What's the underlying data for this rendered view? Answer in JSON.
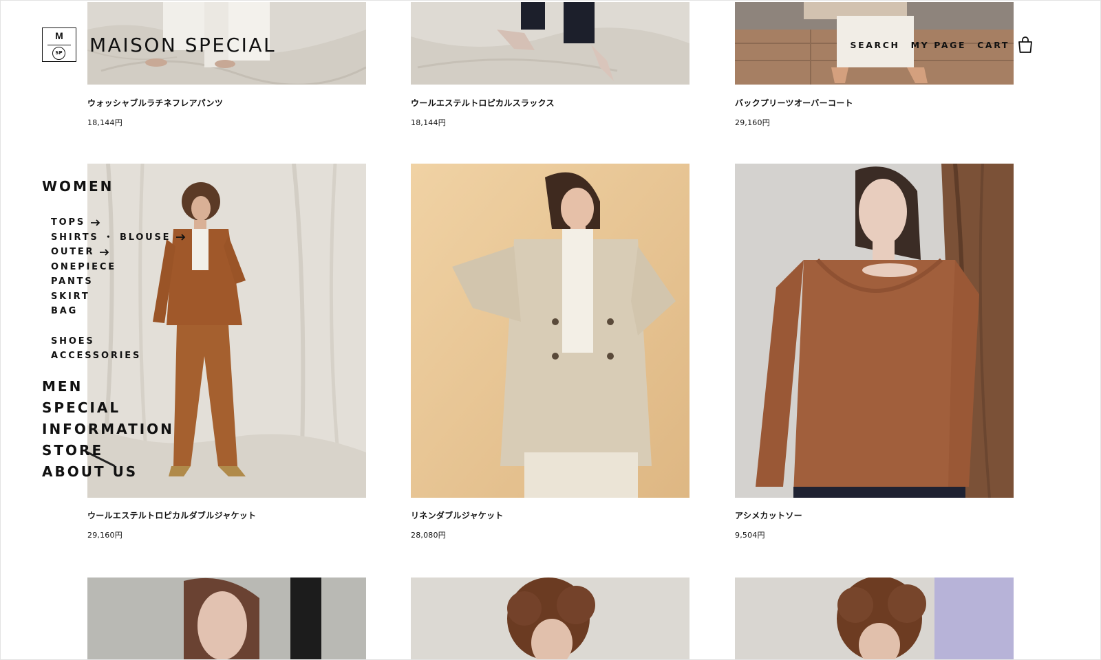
{
  "brand": {
    "logo_letter": "M",
    "logo_sub": "SP",
    "name": "MAISON SPECIAL"
  },
  "utility_nav": {
    "search": "SEARCH",
    "my_page": "MY PAGE",
    "cart": "CART"
  },
  "side_nav": {
    "women": "WOMEN",
    "women_sub": [
      {
        "label": "TOPS",
        "arrow": true
      },
      {
        "label": "SHIRTS ・ BLOUSE",
        "arrow": true
      },
      {
        "label": "OUTER",
        "arrow": true
      },
      {
        "label": "ONEPIECE",
        "arrow": false
      },
      {
        "label": "PANTS",
        "arrow": false
      },
      {
        "label": "SKIRT",
        "arrow": false
      },
      {
        "label": "BAG",
        "arrow": false
      }
    ],
    "women_sub2": [
      {
        "label": "SHOES"
      },
      {
        "label": "ACCESSORIES"
      }
    ],
    "men": "MEN",
    "special": "SPECIAL",
    "information": "INFORMATION",
    "store": "STORE",
    "about_us": "ABOUT US"
  },
  "products": {
    "row1": [
      {
        "name": "ウォッシャブルラチネフレアパンツ",
        "price": "18,144円"
      },
      {
        "name": "ウールエステルトロピカルスラックス",
        "price": "18,144円"
      },
      {
        "name": "バックプリーツオーバーコート",
        "price": "29,160円"
      }
    ],
    "row2": [
      {
        "name": "ウールエステルトロピカルダブルジャケット",
        "price": "29,160円"
      },
      {
        "name": "リネンダブルジャケット",
        "price": "28,080円"
      },
      {
        "name": "アシメカットソー",
        "price": "9,504円"
      }
    ]
  },
  "colors": {
    "text": "#111111",
    "background": "#ffffff"
  }
}
